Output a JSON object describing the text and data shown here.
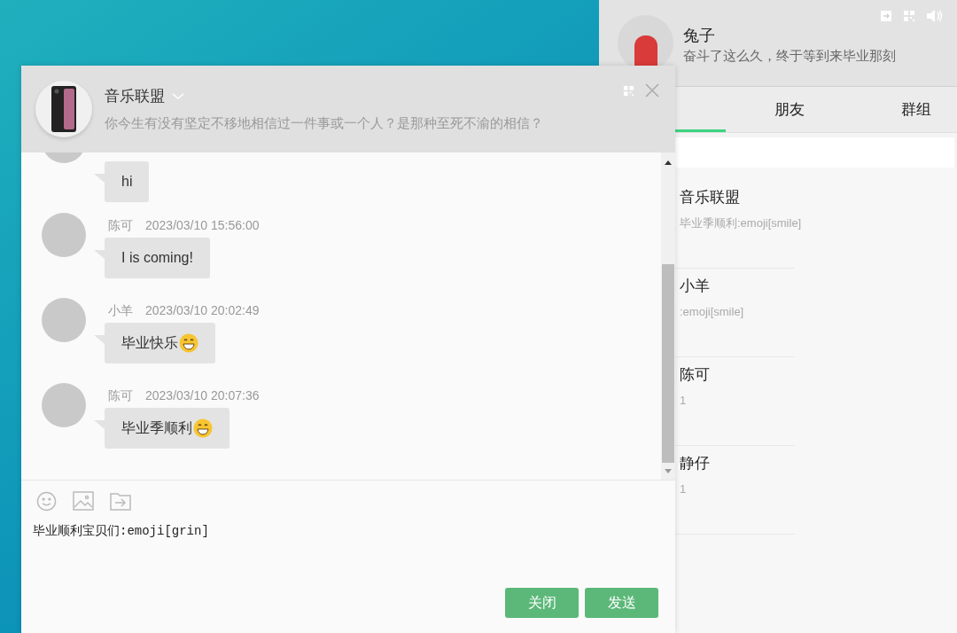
{
  "contact_panel": {
    "user": {
      "name": "兔子",
      "signature": "奋斗了这么久，终于等到来毕业那刻"
    },
    "tabs": [
      {
        "label": "朋友",
        "selected": false
      },
      {
        "label": "群组",
        "selected": false
      }
    ],
    "contacts": [
      {
        "name": "音乐联盟",
        "last_message": "毕业季顺利:emoji[smile]"
      },
      {
        "name": "小羊",
        "last_message": ":emoji[smile]"
      },
      {
        "name": "陈可",
        "last_message": "1"
      },
      {
        "name": "静仔",
        "last_message": "1"
      }
    ]
  },
  "chat_window": {
    "title": "音乐联盟",
    "description": "你今生有没有坚定不移地相信过一件事或一个人？是那种至死不渝的相信？",
    "messages": [
      {
        "text": "hi",
        "has_emoji": false
      },
      {
        "sender": "陈可",
        "time": "2023/03/10 15:56:00",
        "text": "I is coming!",
        "has_emoji": false
      },
      {
        "sender": "小羊",
        "time": "2023/03/10 20:02:49",
        "text": "毕业快乐",
        "has_emoji": true
      },
      {
        "sender": "陈可",
        "time": "2023/03/10 20:07:36",
        "text": "毕业季顺利",
        "has_emoji": true
      }
    ],
    "draft": "毕业顺利宝贝们:emoji[grin]",
    "buttons": [
      "关闭",
      "发送"
    ]
  }
}
